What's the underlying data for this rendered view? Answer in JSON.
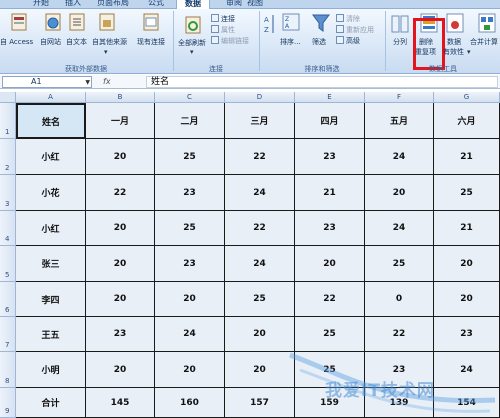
{
  "ribbon_tabs": [
    {
      "label": "开始",
      "active": false
    },
    {
      "label": "插入",
      "active": false
    },
    {
      "label": "页面布局",
      "active": false
    },
    {
      "label": "公式",
      "active": false
    },
    {
      "label": "数据",
      "active": true
    },
    {
      "label": "审阅",
      "active": false
    },
    {
      "label": "视图",
      "active": false
    }
  ],
  "ribbon": {
    "get_external": {
      "access": "自 Access",
      "web": "自网站",
      "text": "自文本",
      "other": "自其他来源",
      "existing": "现有连接",
      "label": "获取外部数据"
    },
    "connections": {
      "refresh_all": "全部刷新",
      "connections": "连接",
      "properties": "属性",
      "edit_links": "编辑链接",
      "label": "连接"
    },
    "sort_filter": {
      "sort": "排序...",
      "filter": "筛选",
      "clear": "清除",
      "reapply": "重新应用",
      "advanced": "高级",
      "label": "排序和筛选"
    },
    "data_tools": {
      "split": "分列",
      "remove_dup_line1": "删除",
      "remove_dup_line2": "重复项",
      "validation_line1": "数据",
      "validation_line2": "有效性",
      "consolidate": "合并计算",
      "label": "数据工具"
    }
  },
  "formula_bar": {
    "name_box": "A1",
    "fx": "fx",
    "content": "姓名"
  },
  "column_headers": [
    "A",
    "B",
    "C",
    "D",
    "E",
    "F",
    "G"
  ],
  "row_headers": [
    "1",
    "2",
    "3",
    "4",
    "5",
    "6",
    "7",
    "8",
    "9"
  ],
  "table": {
    "header": [
      "姓名",
      "一月",
      "二月",
      "三月",
      "四月",
      "五月",
      "六月"
    ],
    "rows": [
      [
        "小红",
        "20",
        "25",
        "22",
        "23",
        "24",
        "21"
      ],
      [
        "小花",
        "22",
        "23",
        "24",
        "21",
        "20",
        "25"
      ],
      [
        "小红",
        "20",
        "25",
        "22",
        "23",
        "24",
        "21"
      ],
      [
        "张三",
        "20",
        "23",
        "24",
        "20",
        "25",
        "20"
      ],
      [
        "李四",
        "20",
        "20",
        "25",
        "22",
        "0",
        "20"
      ],
      [
        "王五",
        "23",
        "24",
        "20",
        "25",
        "22",
        "23"
      ],
      [
        "小明",
        "20",
        "20",
        "20",
        "25",
        "23",
        "24"
      ],
      [
        "合计",
        "145",
        "160",
        "157",
        "159",
        "139",
        "154"
      ]
    ]
  },
  "watermark": "我爱IT技术网",
  "colors": {
    "highlight": "#e3141d",
    "ribbon_bg": "#d9e7f7",
    "cell_bg": "#e9eff7"
  }
}
